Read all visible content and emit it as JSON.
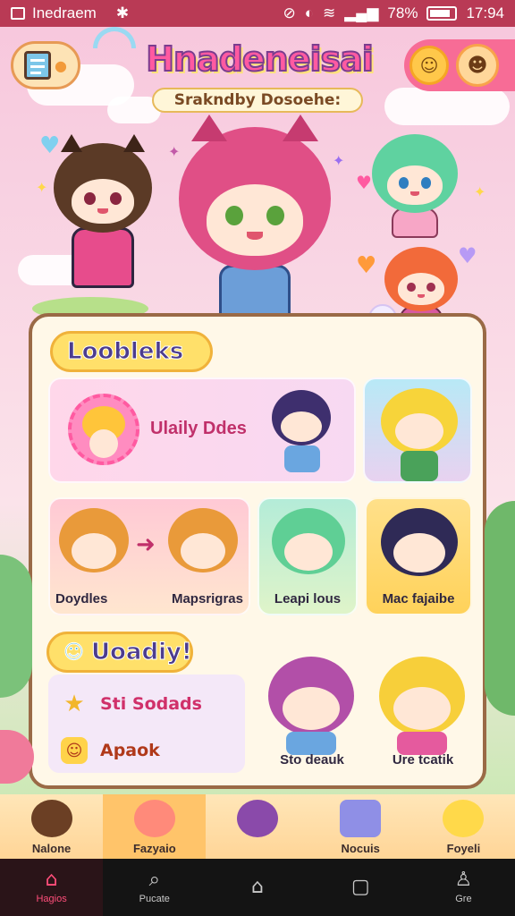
{
  "status_bar": {
    "app_name": "Inedraem",
    "battery": "78%",
    "time": "17:94"
  },
  "header": {
    "title": "Hnadeneisai",
    "subtitle": "Srakndby Dosoehe:"
  },
  "sections": {
    "lookbooks": {
      "title": "Loobleks",
      "featured_label": "Ulaily Ddes",
      "cards": [
        {
          "label": "Doydles"
        },
        {
          "label": "Mapsrigras"
        },
        {
          "label": "Leapi lous"
        },
        {
          "label": "Mac fajaibe"
        }
      ]
    },
    "daily": {
      "title": "Uoadiy!",
      "buttons": [
        {
          "label": "Sti Sodads",
          "icon": "star-icon"
        },
        {
          "label": "Apaok",
          "icon": "gift-icon"
        }
      ],
      "cards": [
        {
          "label": "Sto deauk"
        },
        {
          "label": "Ure tcatik"
        }
      ]
    }
  },
  "dock": {
    "items": [
      {
        "label": "Nalone",
        "color": "#7a4a2a"
      },
      {
        "label": "Fazyaio",
        "color": "#ff7a8a"
      },
      {
        "label": "",
        "color": "#7a4a9e"
      },
      {
        "label": "Nocuis",
        "color": "#6f6fd8"
      },
      {
        "label": "Foyeli",
        "color": "#ffd94a"
      }
    ]
  },
  "nav": {
    "items": [
      {
        "label": "Hagios",
        "icon": "home-icon"
      },
      {
        "label": "Pucate",
        "icon": "search-icon"
      },
      {
        "label": "",
        "icon": "android-home-icon"
      },
      {
        "label": "",
        "icon": "recents-icon"
      },
      {
        "label": "Gre",
        "icon": "profile-icon"
      }
    ]
  },
  "colors": {
    "accent": "#ff5aa1",
    "status_bar": "#b93a55",
    "panel_border": "#9a6a46"
  }
}
